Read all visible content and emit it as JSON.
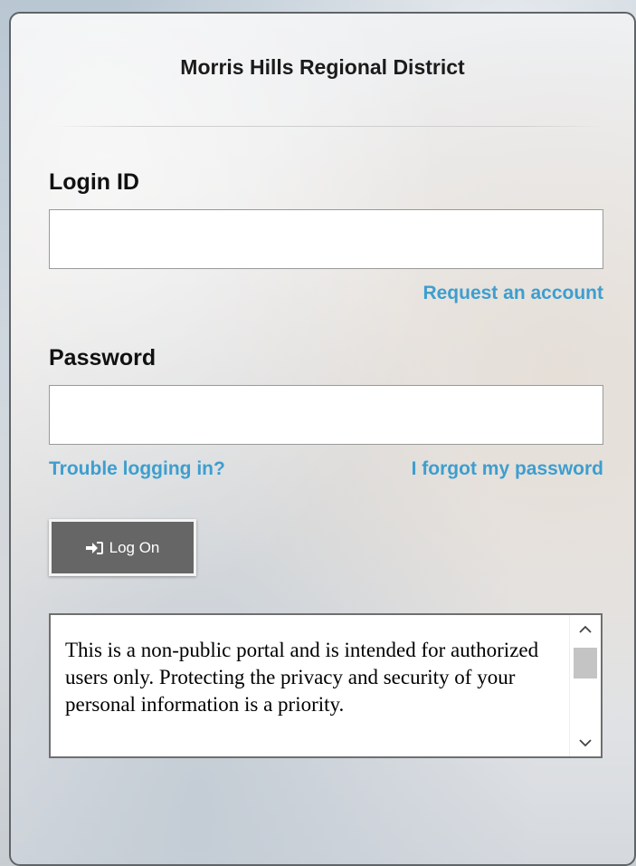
{
  "header": {
    "district_name": "Morris Hills Regional District"
  },
  "login": {
    "login_id_label": "Login ID",
    "login_id_value": "",
    "request_account_link": "Request an account",
    "password_label": "Password",
    "password_value": "",
    "trouble_link": "Trouble logging in?",
    "forgot_password_link": "I forgot my password",
    "logon_button_label": "Log On",
    "logon_icon": "sign-in-icon"
  },
  "notice": {
    "text": "This is a non-public portal and is intended for authorized users only. Protecting the privacy and security of your personal information is a priority."
  },
  "colors": {
    "link": "#3d9ecf",
    "button_bg": "#666666",
    "text": "#111111"
  }
}
